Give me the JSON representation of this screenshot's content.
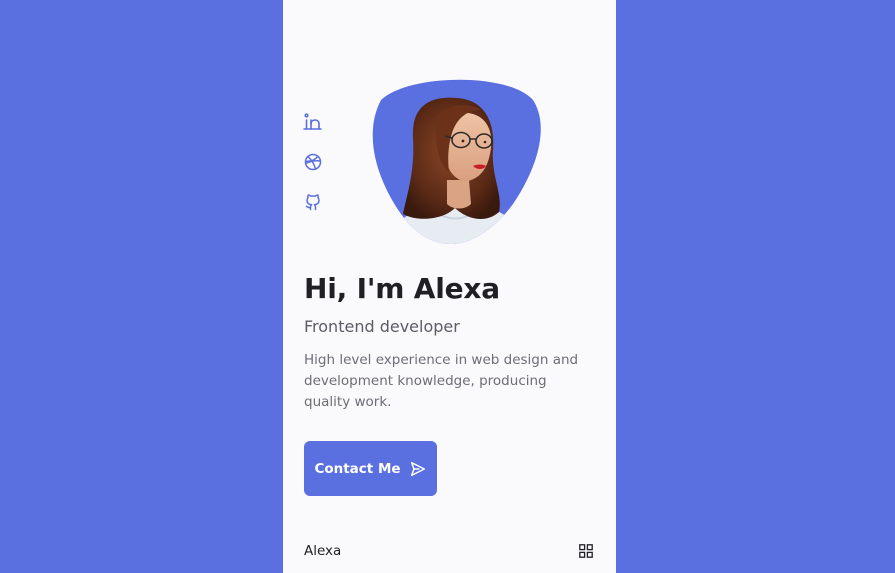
{
  "colors": {
    "accent": "#5a6fe0",
    "card_background": "#fafafc",
    "heading": "#1f1f24",
    "text": "#6d6d78"
  },
  "social": [
    {
      "icon": "linkedin-icon"
    },
    {
      "icon": "dribbble-icon"
    },
    {
      "icon": "github-icon"
    }
  ],
  "hero": {
    "title": "Hi, I'm Alexa",
    "subtitle": "Frontend developer",
    "description": "High level experience in web design and development knowledge, producing quality work.",
    "contact_label": "Contact Me",
    "contact_icon": "send-icon",
    "profile_image": "profile-photo"
  },
  "nav": {
    "logo": "Alexa",
    "menu_icon": "apps-grid-icon"
  }
}
